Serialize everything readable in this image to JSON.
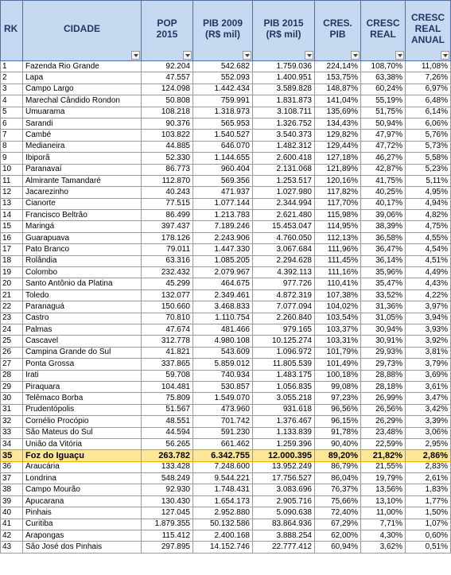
{
  "headers": {
    "rk": "RK",
    "cidade": "CIDADE",
    "pop": [
      "POP",
      "2015"
    ],
    "pib2009": [
      "PIB 2009",
      "(R$ mil)"
    ],
    "pib2015": [
      "PIB 2015",
      "(R$ mil)"
    ],
    "cres_pib": [
      "CRES.",
      "PIB"
    ],
    "cresc_real": [
      "CRESC",
      "REAL"
    ],
    "cresc_real_anual": [
      "CRESC",
      "REAL",
      "ANUAL"
    ]
  },
  "highlight_rank": "35",
  "rows": [
    [
      "1",
      "Fazenda Rio Grande",
      "92.204",
      "542.682",
      "1.759.036",
      "224,14%",
      "108,70%",
      "11,08%"
    ],
    [
      "2",
      "Lapa",
      "47.557",
      "552.093",
      "1.400.951",
      "153,75%",
      "63,38%",
      "7,26%"
    ],
    [
      "3",
      "Campo Largo",
      "124.098",
      "1.442.434",
      "3.589.828",
      "148,87%",
      "60,24%",
      "6,97%"
    ],
    [
      "4",
      "Marechal Cândido Rondon",
      "50.808",
      "759.991",
      "1.831.873",
      "141,04%",
      "55,19%",
      "6,48%"
    ],
    [
      "5",
      "Umuarama",
      "108.218",
      "1.318.973",
      "3.108.711",
      "135,69%",
      "51,75%",
      "6,14%"
    ],
    [
      "6",
      "Sarandi",
      "90.376",
      "565.953",
      "1.326.752",
      "134,43%",
      "50,94%",
      "6,06%"
    ],
    [
      "7",
      "Cambé",
      "103.822",
      "1.540.527",
      "3.540.373",
      "129,82%",
      "47,97%",
      "5,76%"
    ],
    [
      "8",
      "Medianeira",
      "44.885",
      "646.070",
      "1.482.312",
      "129,44%",
      "47,72%",
      "5,73%"
    ],
    [
      "9",
      "Ibiporã",
      "52.330",
      "1.144.655",
      "2.600.418",
      "127,18%",
      "46,27%",
      "5,58%"
    ],
    [
      "10",
      "Paranavaí",
      "86.773",
      "960.404",
      "2.131.068",
      "121,89%",
      "42,87%",
      "5,23%"
    ],
    [
      "11",
      "Almirante Tamandaré",
      "112.870",
      "569.356",
      "1.253.517",
      "120,16%",
      "41,75%",
      "5,11%"
    ],
    [
      "12",
      "Jacarezinho",
      "40.243",
      "471.937",
      "1.027.980",
      "117,82%",
      "40,25%",
      "4,95%"
    ],
    [
      "13",
      "Cianorte",
      "77.515",
      "1.077.144",
      "2.344.994",
      "117,70%",
      "40,17%",
      "4,94%"
    ],
    [
      "14",
      "Francisco Beltrão",
      "86.499",
      "1.213.783",
      "2.621.480",
      "115,98%",
      "39,06%",
      "4,82%"
    ],
    [
      "15",
      "Maringá",
      "397.437",
      "7.189.246",
      "15.453.047",
      "114,95%",
      "38,39%",
      "4,75%"
    ],
    [
      "16",
      "Guarapuava",
      "178.126",
      "2.243.906",
      "4.760.050",
      "112,13%",
      "36,58%",
      "4,55%"
    ],
    [
      "17",
      "Pato Branco",
      "79.011",
      "1.447.330",
      "3.067.684",
      "111,96%",
      "36,47%",
      "4,54%"
    ],
    [
      "18",
      "Rolândia",
      "63.316",
      "1.085.205",
      "2.294.628",
      "111,45%",
      "36,14%",
      "4,51%"
    ],
    [
      "19",
      "Colombo",
      "232.432",
      "2.079.967",
      "4.392.113",
      "111,16%",
      "35,96%",
      "4,49%"
    ],
    [
      "20",
      "Santo Antônio da Platina",
      "45.299",
      "464.675",
      "977.726",
      "110,41%",
      "35,47%",
      "4,43%"
    ],
    [
      "21",
      "Toledo",
      "132.077",
      "2.349.461",
      "4.872.319",
      "107,38%",
      "33,52%",
      "4,22%"
    ],
    [
      "22",
      "Paranaguá",
      "150.660",
      "3.468.833",
      "7.077.094",
      "104,02%",
      "31,36%",
      "3,97%"
    ],
    [
      "23",
      "Castro",
      "70.810",
      "1.110.754",
      "2.260.840",
      "103,54%",
      "31,05%",
      "3,94%"
    ],
    [
      "24",
      "Palmas",
      "47.674",
      "481.466",
      "979.165",
      "103,37%",
      "30,94%",
      "3,93%"
    ],
    [
      "25",
      "Cascavel",
      "312.778",
      "4.980.108",
      "10.125.274",
      "103,31%",
      "30,91%",
      "3,92%"
    ],
    [
      "26",
      "Campina Grande do Sul",
      "41.821",
      "543.609",
      "1.096.972",
      "101,79%",
      "29,93%",
      "3,81%"
    ],
    [
      "27",
      "Ponta Grossa",
      "337.865",
      "5.859.012",
      "11.805.539",
      "101,49%",
      "29,73%",
      "3,79%"
    ],
    [
      "28",
      "Irati",
      "59.708",
      "740.934",
      "1.483.175",
      "100,18%",
      "28,88%",
      "3,69%"
    ],
    [
      "29",
      "Piraquara",
      "104.481",
      "530.857",
      "1.056.835",
      "99,08%",
      "28,18%",
      "3,61%"
    ],
    [
      "30",
      "Telêmaco Borba",
      "75.809",
      "1.549.070",
      "3.055.218",
      "97,23%",
      "26,99%",
      "3,47%"
    ],
    [
      "31",
      "Prudentópolis",
      "51.567",
      "473.960",
      "931.618",
      "96,56%",
      "26,56%",
      "3,42%"
    ],
    [
      "32",
      "Cornélio Procópio",
      "48.551",
      "701.742",
      "1.376.467",
      "96,15%",
      "26,29%",
      "3,39%"
    ],
    [
      "33",
      "São Mateus do Sul",
      "44.594",
      "591.230",
      "1.133.839",
      "91,78%",
      "23,48%",
      "3,06%"
    ],
    [
      "34",
      "União da Vitória",
      "56.265",
      "661.462",
      "1.259.396",
      "90,40%",
      "22,59%",
      "2,95%"
    ],
    [
      "35",
      "Foz do Iguaçu",
      "263.782",
      "6.342.755",
      "12.000.395",
      "89,20%",
      "21,82%",
      "2,86%"
    ],
    [
      "36",
      "Araucária",
      "133.428",
      "7.248.600",
      "13.952.249",
      "86,79%",
      "21,55%",
      "2,83%"
    ],
    [
      "37",
      "Londrina",
      "548.249",
      "9.544.221",
      "17.756.527",
      "86,04%",
      "19,79%",
      "2,61%"
    ],
    [
      "38",
      "Campo Mourão",
      "92.930",
      "1.748.431",
      "3.083.696",
      "76,37%",
      "13,56%",
      "1,83%"
    ],
    [
      "39",
      "Apucarana",
      "130.430",
      "1.654.173",
      "2.905.716",
      "75,66%",
      "13,10%",
      "1,77%"
    ],
    [
      "40",
      "Pinhais",
      "127.045",
      "2.952.880",
      "5.090.638",
      "72,40%",
      "11,00%",
      "1,50%"
    ],
    [
      "41",
      "Curitiba",
      "1.879.355",
      "50.132.586",
      "83.864.936",
      "67,29%",
      "7,71%",
      "1,07%"
    ],
    [
      "42",
      "Arapongas",
      "115.412",
      "2.400.168",
      "3.888.254",
      "62,00%",
      "4,30%",
      "0,60%"
    ],
    [
      "43",
      "São José dos Pinhais",
      "297.895",
      "14.152.746",
      "22.777.412",
      "60,94%",
      "3,62%",
      "0,51%"
    ]
  ]
}
